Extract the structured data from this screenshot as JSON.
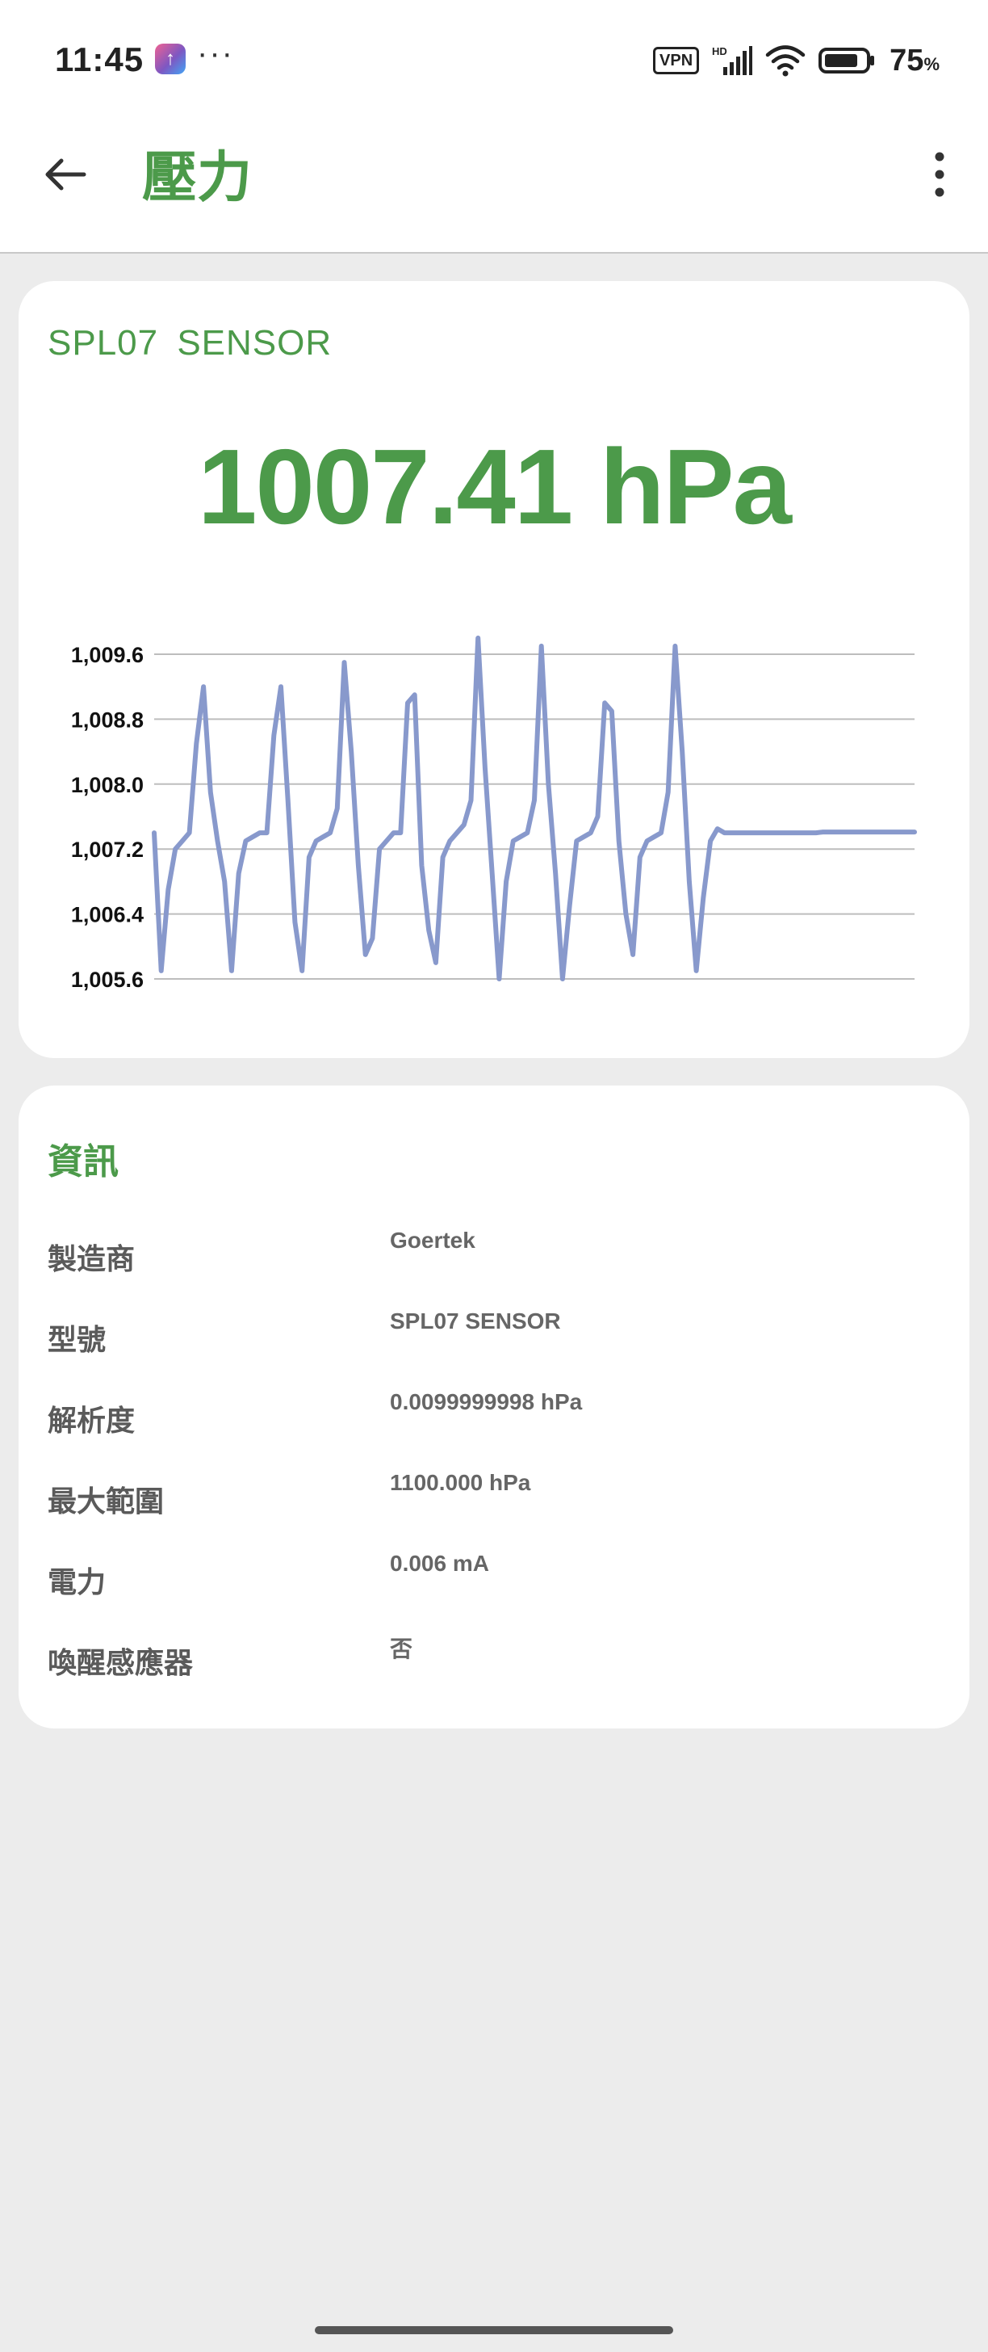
{
  "status_bar": {
    "time": "11:45",
    "dots": "···",
    "vpn": "VPN",
    "battery_pct": "75",
    "battery_unit": "%",
    "icons": [
      "app-icon",
      "vpn-icon",
      "hd-signal-icon",
      "wifi-icon",
      "battery-icon"
    ]
  },
  "app_bar": {
    "title": "壓力",
    "icons": [
      "back-arrow-icon",
      "overflow-menu-icon"
    ]
  },
  "sensor_card": {
    "name": "SPL07  SENSOR",
    "reading": "1007.41 hPa"
  },
  "chart_data": {
    "type": "line",
    "title": "",
    "xlabel": "",
    "ylabel": "",
    "ylim": [
      1005.6,
      1009.6
    ],
    "yticks": [
      1009.6,
      1008.8,
      1008.0,
      1007.2,
      1006.4,
      1005.6
    ],
    "ytick_labels": [
      "1,009.6",
      "1,008.8",
      "1,008.0",
      "1,007.2",
      "1,006.4",
      "1,005.6"
    ],
    "grid": true,
    "line_color": "#8899cc",
    "series": [
      {
        "values": [
          1007.4,
          1005.7,
          1006.7,
          1007.2,
          1007.3,
          1007.4,
          1008.5,
          1009.2,
          1007.9,
          1007.3,
          1006.8,
          1005.7,
          1006.9,
          1007.3,
          1007.35,
          1007.4,
          1007.4,
          1008.6,
          1009.2,
          1007.8,
          1006.3,
          1005.7,
          1007.1,
          1007.3,
          1007.35,
          1007.4,
          1007.7,
          1009.5,
          1008.4,
          1007.0,
          1005.9,
          1006.1,
          1007.2,
          1007.3,
          1007.4,
          1007.4,
          1009.0,
          1009.1,
          1007.0,
          1006.2,
          1005.8,
          1007.1,
          1007.3,
          1007.4,
          1007.5,
          1007.8,
          1009.8,
          1008.2,
          1006.9,
          1005.6,
          1006.8,
          1007.3,
          1007.35,
          1007.4,
          1007.8,
          1009.7,
          1008.0,
          1006.9,
          1005.6,
          1006.5,
          1007.3,
          1007.35,
          1007.4,
          1007.6,
          1009.0,
          1008.9,
          1007.3,
          1006.4,
          1005.9,
          1007.1,
          1007.3,
          1007.35,
          1007.4,
          1007.9,
          1009.7,
          1008.4,
          1006.8,
          1005.7,
          1006.6,
          1007.3,
          1007.45,
          1007.4,
          1007.4,
          1007.4,
          1007.4,
          1007.4,
          1007.4,
          1007.4,
          1007.4,
          1007.4,
          1007.4,
          1007.4,
          1007.4,
          1007.4,
          1007.4,
          1007.41,
          1007.41,
          1007.41,
          1007.41,
          1007.41,
          1007.41,
          1007.41,
          1007.41,
          1007.41,
          1007.41,
          1007.41,
          1007.41,
          1007.41,
          1007.41
        ]
      }
    ]
  },
  "info_card": {
    "title": "資訊",
    "rows": [
      {
        "label": "製造商",
        "value": "Goertek"
      },
      {
        "label": "型號",
        "value": "SPL07  SENSOR"
      },
      {
        "label": "解析度",
        "value": "0.0099999998 hPa"
      },
      {
        "label": "最大範圍",
        "value": "1100.000 hPa"
      },
      {
        "label": "電力",
        "value": "0.006 mA"
      },
      {
        "label": "喚醒感應器",
        "value": "否"
      }
    ]
  }
}
